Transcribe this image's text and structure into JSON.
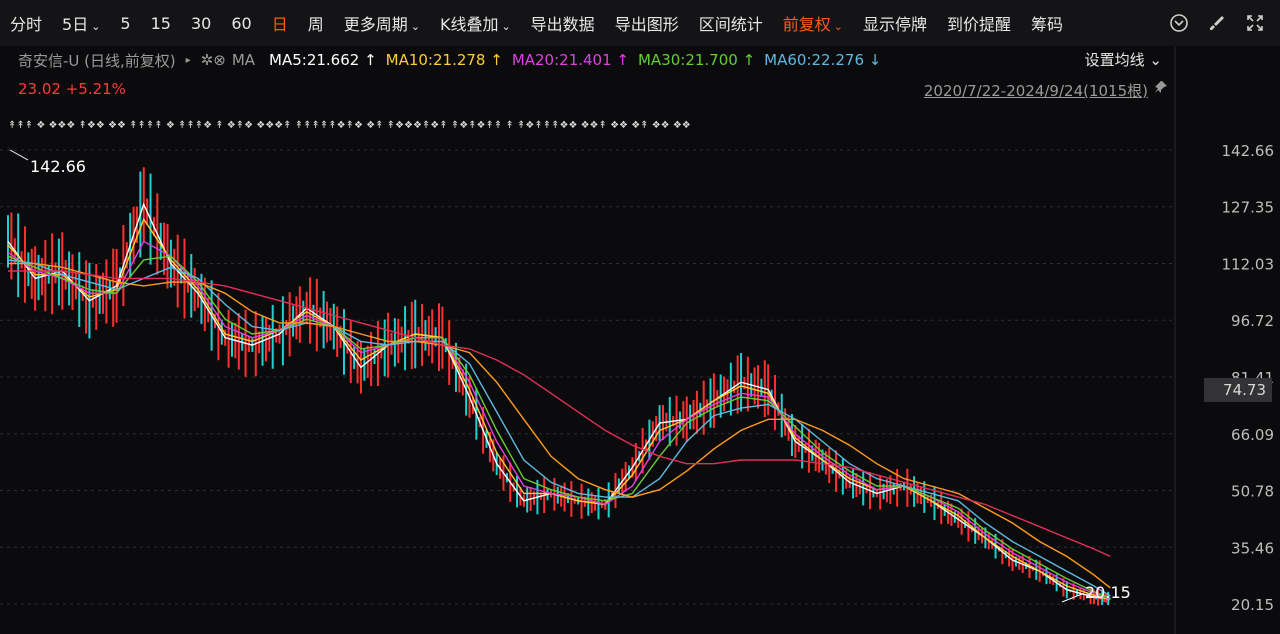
{
  "toolbar": {
    "items": [
      {
        "label": "分时"
      },
      {
        "label": "5日",
        "chevron": "⌄"
      },
      {
        "label": "5"
      },
      {
        "label": "15"
      },
      {
        "label": "30"
      },
      {
        "label": "60"
      },
      {
        "label": "日",
        "active": true
      },
      {
        "label": "周"
      },
      {
        "label": "更多周期",
        "chevron": "⌄"
      },
      {
        "label": "K线叠加",
        "chevron": "⌄"
      },
      {
        "label": "导出数据"
      },
      {
        "label": "导出图形"
      },
      {
        "label": "区间统计"
      },
      {
        "label": "前复权",
        "chevron": "⌄",
        "active": true
      },
      {
        "label": "显示停牌"
      },
      {
        "label": "到价提醒"
      },
      {
        "label": "筹码"
      }
    ],
    "icons": [
      "chevron-circle-icon",
      "brush-icon",
      "fullscreen-icon"
    ]
  },
  "info": {
    "title": "奇安信-U (日线,前复权)",
    "triangle": "▸",
    "gear": "✲⊗",
    "ma_label": "MA",
    "ma": [
      {
        "text": "MA5:21.662 ↑",
        "color": "#ffffff"
      },
      {
        "text": "MA10:21.278 ↑",
        "color": "#ffcc33"
      },
      {
        "text": "MA20:21.401 ↑",
        "color": "#e040e0"
      },
      {
        "text": "MA30:21.700 ↑",
        "color": "#66cc33"
      },
      {
        "text": "MA60:22.276 ↓",
        "color": "#5fb8e0"
      }
    ],
    "set_ma": "设置均线 ⌄"
  },
  "price": {
    "text": "23.02  +5.21%"
  },
  "range": {
    "text": "2020/7/22-2024/9/24(1015根)",
    "pin": "📌"
  },
  "markers": "↟↟↟ ❖ ❖❖❖  ↟❖❖  ❖❖  ↟↟↟↟ ❖  ↟↟↟❖ ↟ ❖↟❖ ❖❖❖↟ ↟↟↟↟↟❖↟❖ ❖↟ ↟❖❖❖↟❖↟ ↟❖↟❖↟↟ ↟ ↟❖↟↟↟❖❖  ❖❖↟  ❖❖ ❖↟ ❖❖  ❖❖",
  "chart_data": {
    "type": "line",
    "title": "",
    "ylim": [
      20.15,
      142.66
    ],
    "y_ticks": [
      "142.66",
      "127.35",
      "112.03",
      "96.72",
      "81.41",
      "66.09",
      "50.78",
      "35.46",
      "20.15"
    ],
    "annotations": {
      "high": "142.66",
      "low": "20.15",
      "last": "74.73"
    },
    "x": [
      0,
      25,
      50,
      75,
      100,
      125,
      150,
      175,
      200,
      225,
      250,
      275,
      300,
      325,
      350,
      375,
      400,
      425,
      450,
      475,
      500,
      525,
      550,
      575,
      600,
      625,
      650,
      675,
      700,
      725,
      750,
      775,
      800,
      825,
      850,
      875,
      900,
      925,
      950,
      975,
      1000,
      1015
    ],
    "series": [
      {
        "name": "MA5",
        "color": "#ffffff",
        "values": [
          118,
          108,
          110,
          102,
          106,
          128,
          112,
          104,
          92,
          90,
          93,
          100,
          95,
          84,
          90,
          93,
          92,
          76,
          58,
          48,
          50,
          48,
          47,
          57,
          69,
          70,
          75,
          80,
          78,
          64,
          59,
          53,
          50,
          52,
          48,
          43,
          38,
          32,
          29,
          24,
          22,
          21.6
        ]
      },
      {
        "name": "MA10",
        "color": "#ffcc33",
        "values": [
          117,
          109,
          109,
          103,
          105,
          124,
          113,
          105,
          93,
          91,
          94,
          99,
          95,
          86,
          90,
          93,
          92,
          78,
          61,
          50,
          50,
          48,
          47,
          55,
          67,
          70,
          75,
          79,
          77,
          65,
          59,
          54,
          51,
          52,
          48,
          44,
          38,
          33,
          29,
          25,
          22.5,
          21.3
        ]
      },
      {
        "name": "MA20",
        "color": "#e040e0",
        "values": [
          115,
          110,
          108,
          104,
          104,
          118,
          114,
          106,
          95,
          92,
          94,
          98,
          95,
          88,
          90,
          92,
          92,
          80,
          64,
          52,
          50,
          49,
          47,
          52,
          64,
          70,
          74,
          77,
          76,
          66,
          60,
          55,
          51,
          52,
          49,
          45,
          39,
          34,
          30,
          26,
          23,
          21.4
        ]
      },
      {
        "name": "MA30",
        "color": "#66cc33",
        "values": [
          114,
          111,
          108,
          105,
          104,
          113,
          114,
          107,
          97,
          93,
          94,
          97,
          95,
          89,
          90,
          92,
          92,
          82,
          67,
          54,
          51,
          49,
          48,
          50,
          60,
          69,
          73,
          76,
          75,
          68,
          61,
          56,
          52,
          52,
          49,
          46,
          40,
          35,
          31,
          27,
          23.5,
          21.7
        ]
      },
      {
        "name": "MA60",
        "color": "#5fb8e0",
        "values": [
          113,
          112,
          109,
          107,
          105,
          108,
          111,
          108,
          101,
          95,
          94,
          96,
          95,
          91,
          90,
          91,
          91,
          85,
          72,
          59,
          53,
          50,
          49,
          49,
          54,
          64,
          71,
          73,
          74,
          70,
          64,
          58,
          54,
          52,
          50,
          48,
          42,
          37,
          33,
          29,
          25,
          22.3
        ]
      },
      {
        "name": "MA120",
        "color": "#ff9a1f",
        "values": [
          112,
          112,
          111,
          109,
          107,
          106,
          107,
          107,
          104,
          99,
          96,
          96,
          95,
          93,
          91,
          91,
          90,
          88,
          80,
          70,
          60,
          54,
          51,
          49,
          51,
          56,
          62,
          67,
          70,
          70,
          67,
          63,
          58,
          54,
          52,
          50,
          46,
          42,
          37,
          33,
          28,
          24.5
        ]
      },
      {
        "name": "MA250",
        "color": "#e0305a",
        "values": [
          110,
          110,
          110,
          109,
          108,
          108,
          108,
          107,
          106,
          104,
          102,
          100,
          98,
          96,
          94,
          92,
          90,
          89,
          86,
          82,
          77,
          72,
          67,
          63,
          60,
          58,
          58,
          59,
          59,
          59,
          58,
          57,
          55,
          53,
          51,
          49,
          47,
          44,
          41,
          38,
          35,
          33
        ]
      }
    ]
  }
}
